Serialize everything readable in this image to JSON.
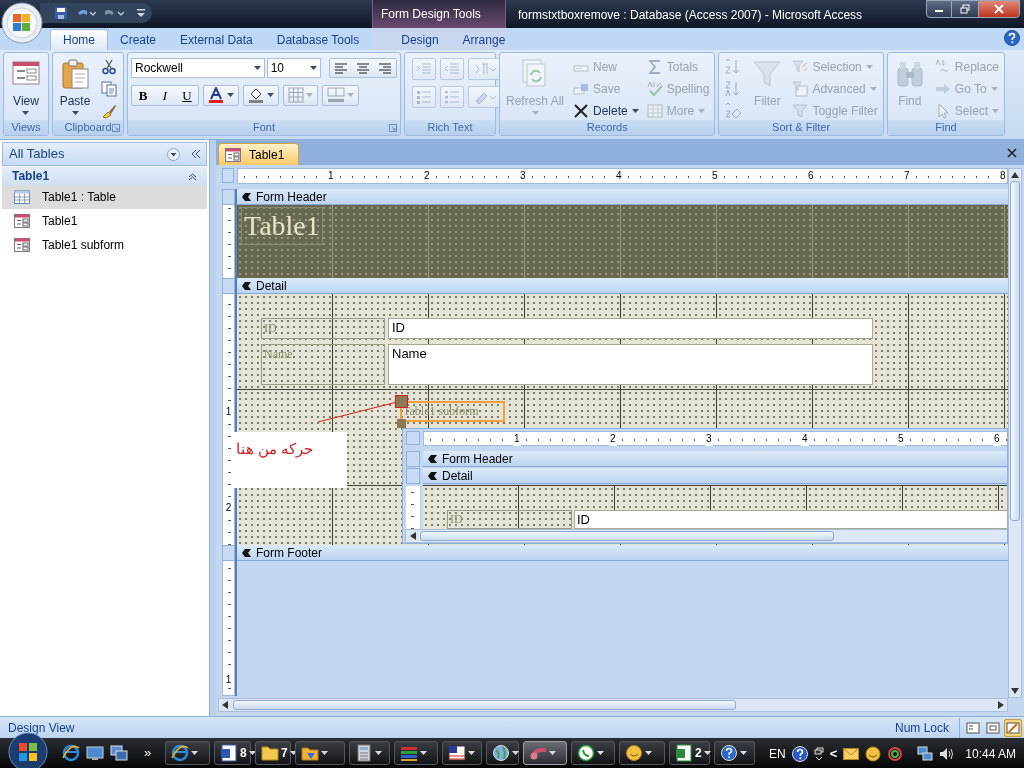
{
  "title_bar": {
    "context_label": "Form Design Tools",
    "title": "formstxtboxremove : Database (Access 2007) - Microsoft Access"
  },
  "tabs": [
    {
      "label": "Home",
      "selected": true,
      "kind": "standard"
    },
    {
      "label": "Create",
      "selected": false,
      "kind": "standard"
    },
    {
      "label": "External Data",
      "selected": false,
      "kind": "standard"
    },
    {
      "label": "Database Tools",
      "selected": false,
      "kind": "standard"
    },
    {
      "label": "Design",
      "selected": false,
      "kind": "contextual"
    },
    {
      "label": "Arrange",
      "selected": false,
      "kind": "contextual"
    }
  ],
  "ribbon": {
    "groups": [
      {
        "label": "Views",
        "kind": "buttons",
        "items": [
          {
            "kind": "large",
            "label": "View",
            "disabled": false,
            "dropdown": true
          }
        ]
      },
      {
        "label": "Clipboard",
        "kind": "buttons",
        "items": [
          {
            "kind": "large",
            "label": "Paste",
            "disabled": false,
            "dropdown": true
          },
          {
            "kind": "icon",
            "disabled": false
          },
          {
            "kind": "icon",
            "disabled": false
          },
          {
            "kind": "icon",
            "disabled": false
          }
        ]
      },
      {
        "label": "Font",
        "kind": "font",
        "font_name": "Rockwell",
        "font_size": "10",
        "format_buttons": [
          "B",
          "I",
          "U"
        ]
      },
      {
        "label": "Rich Text",
        "kind": "icon_grid",
        "items": [
          {
            "kind": "icon",
            "disabled": true
          },
          {
            "kind": "icon",
            "disabled": true
          },
          {
            "kind": "icon",
            "disabled": true
          },
          {
            "kind": "icon",
            "disabled": true
          },
          {
            "kind": "icon",
            "disabled": true
          },
          {
            "kind": "icon",
            "disabled": true
          }
        ]
      },
      {
        "label": "Records",
        "kind": "buttons",
        "items": [
          {
            "kind": "large",
            "label": "Refresh All",
            "disabled": true,
            "dropdown": true
          },
          {
            "kind": "small",
            "label": "New",
            "disabled": true,
            "dropdown": false
          },
          {
            "kind": "small",
            "label": "Save",
            "disabled": true,
            "dropdown": false
          },
          {
            "kind": "small",
            "label": "Delete",
            "disabled": false,
            "dropdown": true
          },
          {
            "kind": "small",
            "label": "Totals",
            "disabled": true,
            "dropdown": false
          },
          {
            "kind": "small",
            "label": "Spelling",
            "disabled": true,
            "dropdown": false
          },
          {
            "kind": "small",
            "label": "More",
            "disabled": true,
            "dropdown": true
          }
        ]
      },
      {
        "label": "Sort & Filter",
        "kind": "buttons",
        "items": [
          {
            "kind": "icon",
            "disabled": true
          },
          {
            "kind": "icon",
            "disabled": true
          },
          {
            "kind": "icon",
            "disabled": true
          },
          {
            "kind": "large",
            "label": "Filter",
            "disabled": true,
            "dropdown": false
          },
          {
            "kind": "small",
            "label": "Selection",
            "disabled": true,
            "dropdown": true
          },
          {
            "kind": "small",
            "label": "Advanced",
            "disabled": true,
            "dropdown": true
          },
          {
            "kind": "small",
            "label": "Toggle Filter",
            "disabled": true,
            "dropdown": false
          }
        ]
      },
      {
        "label": "Find",
        "kind": "buttons",
        "items": [
          {
            "kind": "large",
            "label": "Find",
            "disabled": true,
            "dropdown": false
          },
          {
            "kind": "small",
            "label": "Replace",
            "disabled": true,
            "dropdown": false
          },
          {
            "kind": "small",
            "label": "Go To",
            "disabled": true,
            "dropdown": true
          },
          {
            "kind": "small",
            "label": "Select",
            "disabled": true,
            "dropdown": true
          }
        ]
      }
    ]
  },
  "navigation_pane": {
    "header": "All Tables",
    "group": "Table1",
    "items": [
      {
        "label": "Table1 : Table",
        "kind": "table",
        "selected": true
      },
      {
        "label": "Table1",
        "kind": "form",
        "selected": false
      },
      {
        "label": "Table1 subform",
        "kind": "form",
        "selected": false
      }
    ]
  },
  "document_tab": {
    "label": "Table1"
  },
  "designer": {
    "ruler_marks": [
      "1",
      "2",
      "3",
      "4",
      "5",
      "6",
      "7",
      "8"
    ],
    "vertical_ruler_marks": [
      "1",
      "2",
      "1"
    ],
    "form_header": {
      "bar": "Form Header",
      "title": "Table1"
    },
    "detail": {
      "bar": "Detail",
      "labels": [
        "ID",
        "Name"
      ],
      "text_boxes": [
        "ID",
        "Name"
      ],
      "subform_label": "Table1 subform",
      "annotation": "حركه من هنا",
      "subform": {
        "ruler_marks": [
          "1",
          "2",
          "3",
          "4",
          "5",
          "6"
        ],
        "header_bar": "Form Header",
        "detail_bar": "Detail",
        "label": "ID",
        "text_box": "ID"
      }
    },
    "form_footer": {
      "bar": "Form Footer"
    }
  },
  "status_bar": {
    "left": "Design View",
    "right": "Num Lock",
    "views": [
      {
        "selected": false
      },
      {
        "selected": false
      },
      {
        "selected": true
      }
    ]
  },
  "taskbar": {
    "overflow": "»",
    "buttons": [
      {
        "active": false
      },
      {
        "count": "8",
        "active": false
      },
      {
        "count": "7",
        "active": false
      },
      {
        "active": false
      },
      {
        "active": false
      },
      {
        "active": false
      },
      {
        "active": false
      },
      {
        "active": false
      },
      {
        "active": true
      },
      {
        "active": false
      },
      {
        "active": false
      },
      {
        "count": "2",
        "active": false
      },
      {
        "active": false
      }
    ],
    "language": "EN",
    "tray_arrow": "<",
    "clock": "10:44 AM"
  }
}
